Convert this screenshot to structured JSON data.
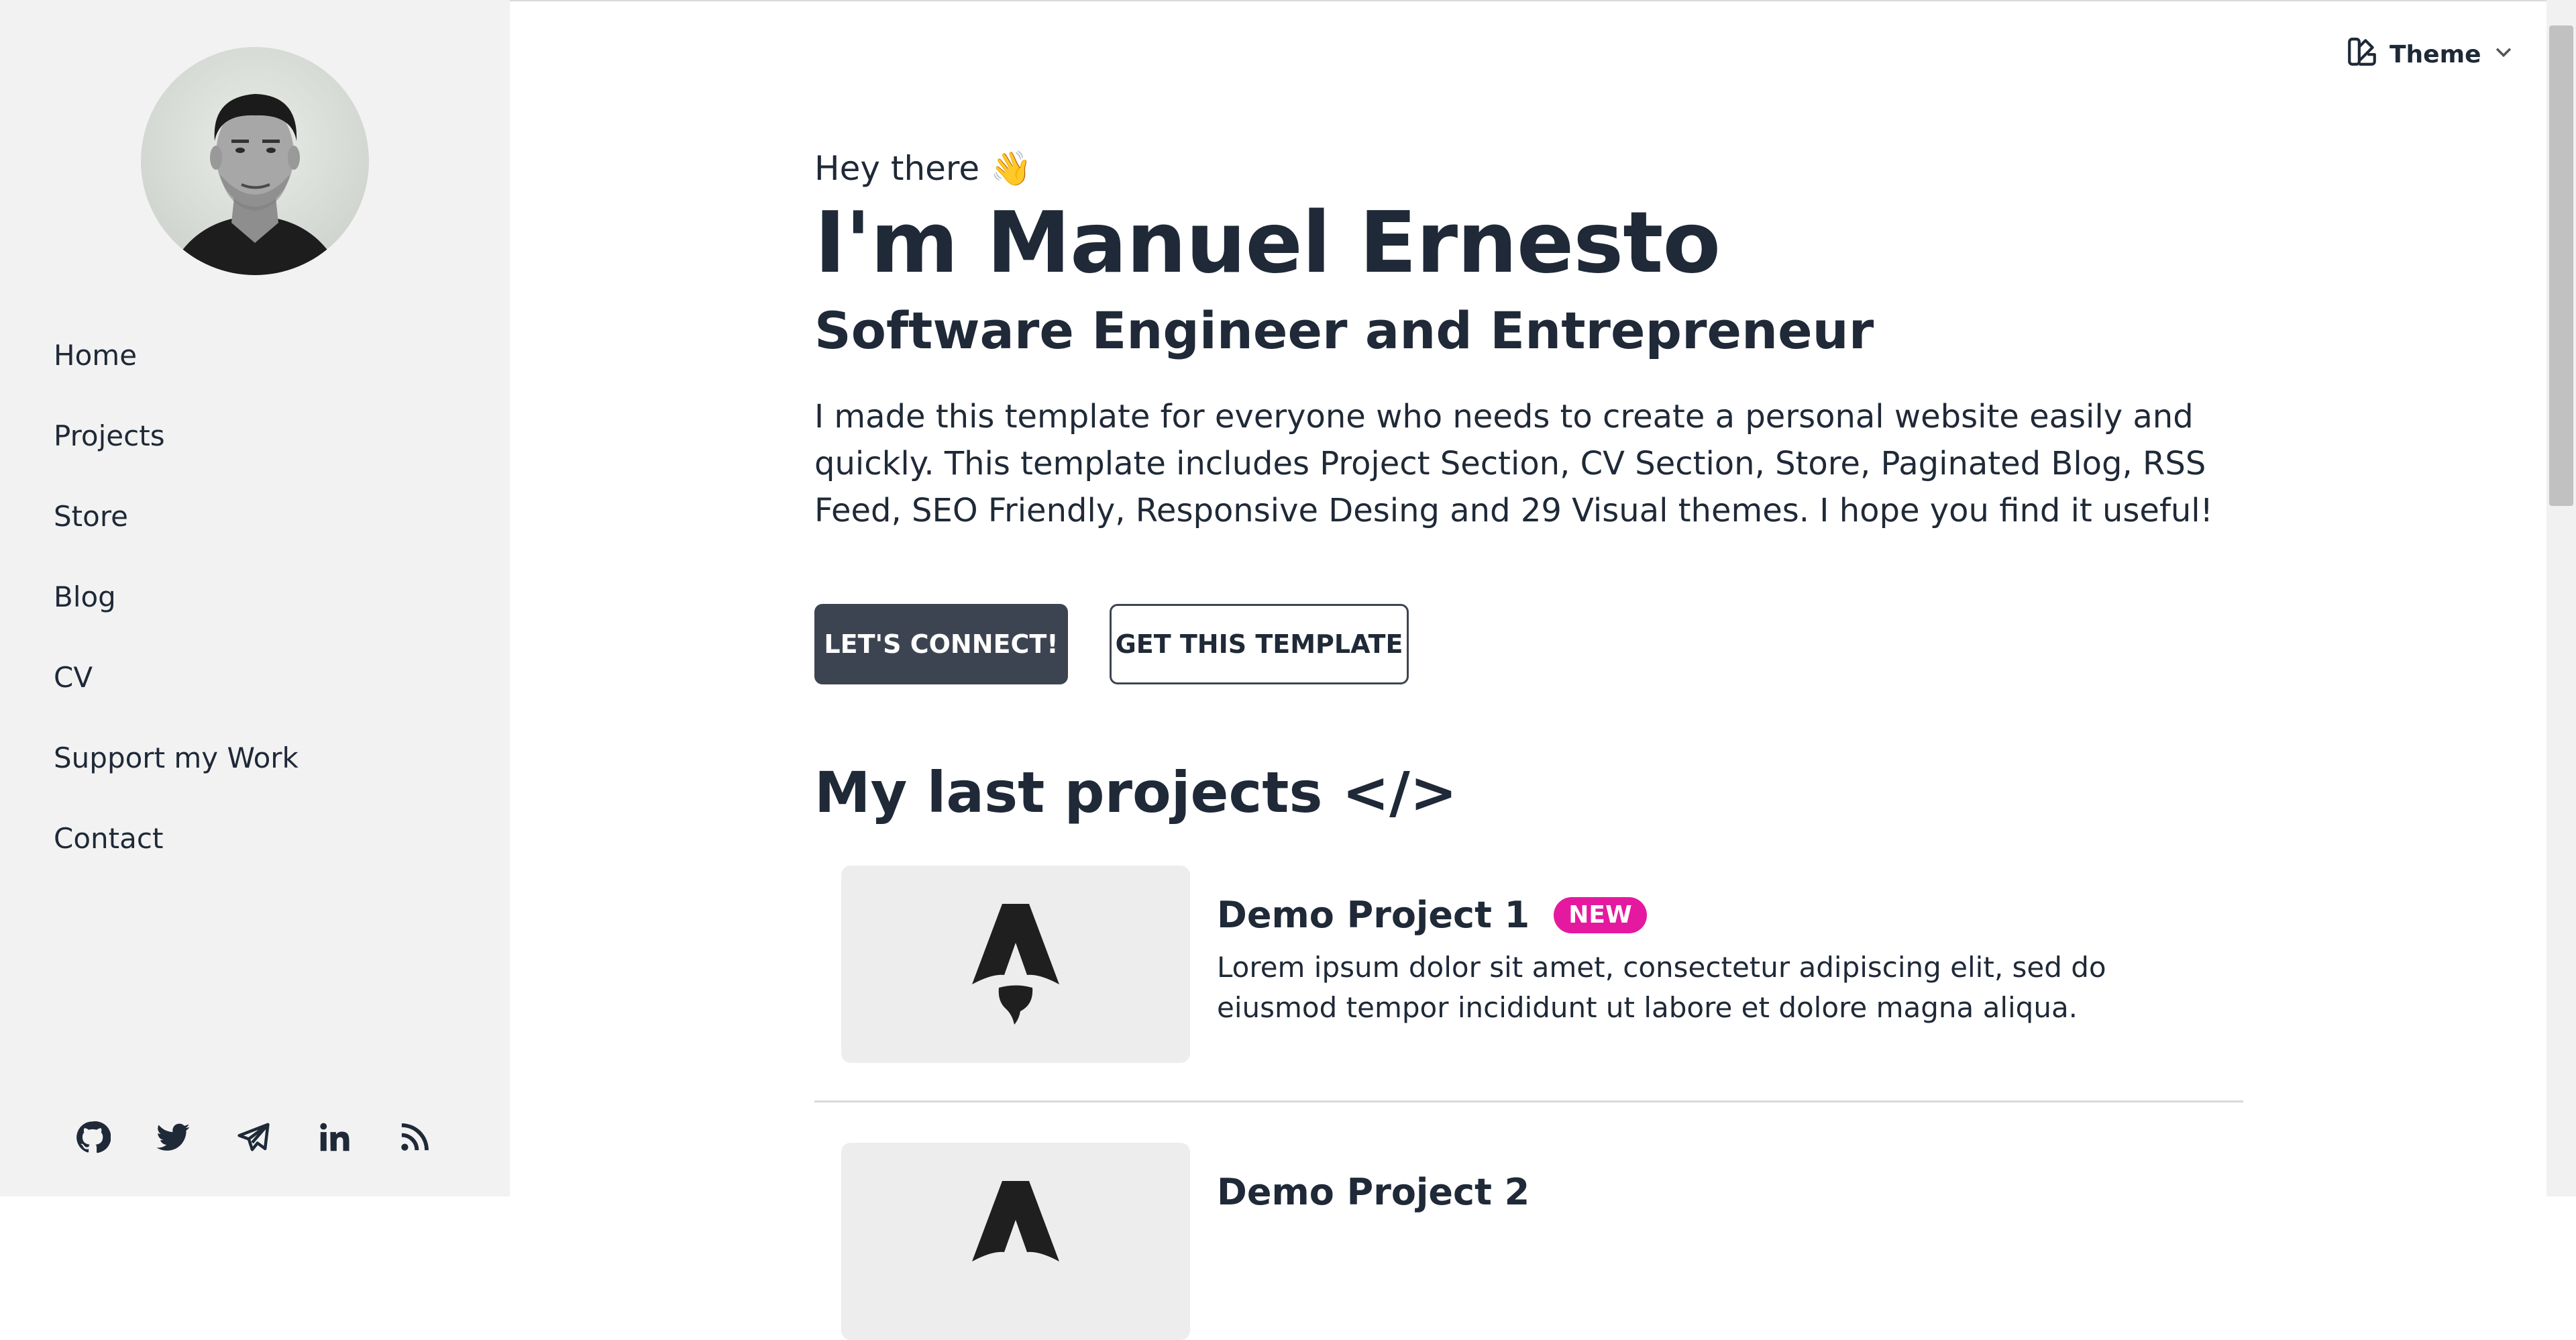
{
  "sidebar": {
    "nav": [
      "Home",
      "Projects",
      "Store",
      "Blog",
      "CV",
      "Support my Work",
      "Contact"
    ],
    "socials": [
      "github-icon",
      "twitter-icon",
      "telegram-icon",
      "linkedin-icon",
      "rss-icon"
    ]
  },
  "header": {
    "theme_label": "Theme"
  },
  "hero": {
    "greeting": "Hey there 👋",
    "name": "I'm Manuel Ernesto",
    "role": "Software Engineer and Entrepreneur",
    "intro": "I made this template for everyone who needs to create a personal website easily and quickly. This template includes Project Section, CV Section, Store, Paginated Blog, RSS Feed, SEO Friendly, Responsive Desing and 29 Visual themes. I hope you find it useful!",
    "primary_button": "LET'S CONNECT!",
    "secondary_button": "GET THIS TEMPLATE"
  },
  "projects": {
    "title": "My last projects </>",
    "items": [
      {
        "title": "Demo Project 1",
        "badge": "NEW",
        "description": "Lorem ipsum dolor sit amet, consectetur adipiscing elit, sed do eiusmod tempor incididunt ut labore et dolore magna aliqua."
      },
      {
        "title": "Demo Project 2"
      }
    ]
  },
  "colors": {
    "accent": "#3d4451",
    "badge": "#e5199f",
    "sidebar_bg": "#f2f2f2"
  }
}
